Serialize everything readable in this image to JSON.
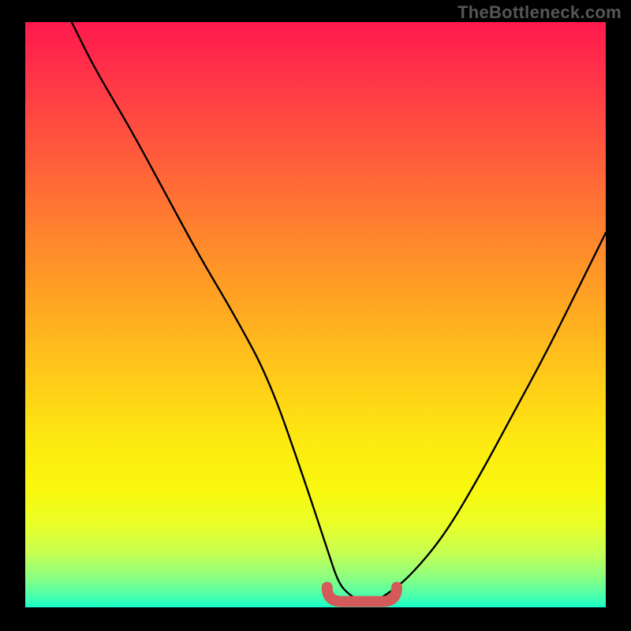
{
  "watermark": "TheBottleneck.com",
  "chart_data": {
    "type": "line",
    "title": "",
    "xlabel": "",
    "ylabel": "",
    "xlim": [
      0,
      100
    ],
    "ylim": [
      0,
      100
    ],
    "series": [
      {
        "name": "bottleneck-curve",
        "x": [
          8,
          12,
          18,
          24,
          30,
          36,
          42,
          48,
          52,
          54,
          56,
          58,
          60,
          62,
          66,
          72,
          78,
          84,
          90,
          96,
          100
        ],
        "values": [
          100,
          92,
          82,
          71,
          60,
          50,
          39,
          22,
          10,
          4,
          2,
          1,
          1,
          2,
          5,
          12,
          22,
          33,
          44,
          56,
          64
        ]
      }
    ],
    "annotations": [
      {
        "name": "valley-marker",
        "x_start": 52,
        "x_end": 64,
        "y": 1
      }
    ],
    "legend": false,
    "grid": false
  },
  "colors": {
    "background": "#000000",
    "gradient_top": "#ff1a4d",
    "gradient_bottom": "#19ffca",
    "curve": "#000000",
    "valley_marker": "#d45a5a",
    "watermark": "#565656"
  }
}
